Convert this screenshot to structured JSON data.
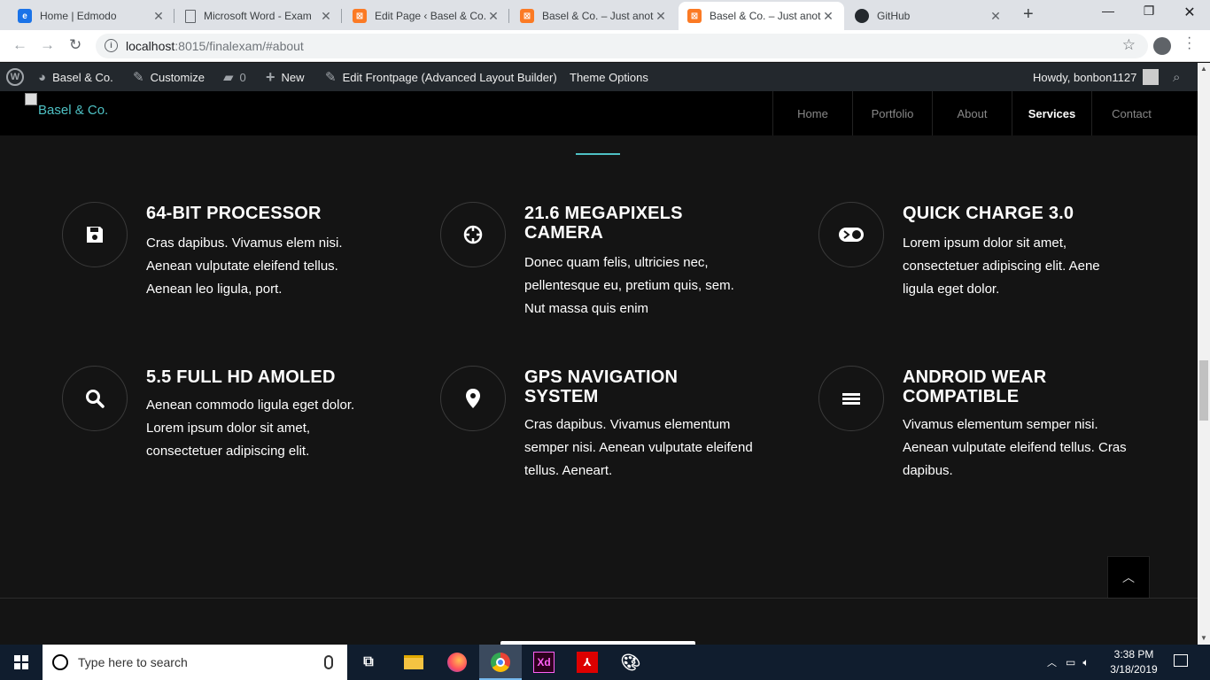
{
  "browser": {
    "tabs": [
      {
        "title": "Home | Edmodo",
        "icon": "edmodo-icon",
        "color": "#1a73e8"
      },
      {
        "title": "Microsoft Word - Exam",
        "icon": "document-icon",
        "color": "#5f6368"
      },
      {
        "title": "Edit Page ‹ Basel & Co.",
        "icon": "xampp-icon",
        "color": "#fb7a24"
      },
      {
        "title": "Basel & Co. – Just anoth",
        "icon": "xampp-icon",
        "color": "#fb7a24"
      },
      {
        "title": "Basel & Co. – Just anoth",
        "icon": "xampp-icon",
        "color": "#fb7a24"
      },
      {
        "title": "GitHub",
        "icon": "github-icon",
        "color": "#24292e"
      }
    ],
    "url_host": "localhost",
    "url_rest": ":8015/finalexam/#about"
  },
  "wpbar": {
    "site": "Basel & Co.",
    "customize": "Customize",
    "comments": "0",
    "new": "New",
    "edit_frontpage": "Edit Frontpage (Advanced Layout Builder)",
    "theme_options": "Theme Options",
    "howdy": "Howdy, bonbon1127"
  },
  "site": {
    "logo": "Basel & Co.",
    "nav": [
      "Home",
      "Portfolio",
      "About",
      "Services",
      "Contact"
    ],
    "active_nav": "Services",
    "accent": "#4ec1c4"
  },
  "features": [
    {
      "title": "64-BIT PROCESSOR",
      "text": "Cras dapibus. Vivamus elem nisi. Aenean vulputate eleifend tellus. Aenean leo ligula, port.",
      "icon": "floppy-disk-icon"
    },
    {
      "title": "21.6 MEGAPIXELS CAMERA",
      "text": "Donec quam felis, ultricies nec, pellentesque eu, pretium quis, sem. Nut massa quis enim",
      "icon": "crosshair-icon"
    },
    {
      "title": "QUICK CHARGE 3.0",
      "text": "Lorem ipsum dolor sit amet, consectetuer adipiscing elit. Aene ligula eget dolor.",
      "icon": "toggle-icon"
    },
    {
      "title": "5.5 FULL HD AMOLED",
      "text": "Aenean commodo ligula eget dolor. Lorem ipsum dolor sit amet, consectetuer adipiscing elit.",
      "icon": "search-icon"
    },
    {
      "title": "GPS NAVIGATION SYSTEM",
      "text": "Cras dapibus. Vivamus elementum semper nisi. Aenean vulputate eleifend tellus. Aeneart.",
      "icon": "map-pin-icon"
    },
    {
      "title": "ANDROID WEAR COMPATIBLE",
      "text": "Vivamus elementum semper nisi. Aenean vulputate eleifend tellus. Cras dapibus.",
      "icon": "hamburger-icon"
    }
  ],
  "taskbar": {
    "search_placeholder": "Type here to search",
    "time": "3:38 PM",
    "date": "3/18/2019"
  }
}
